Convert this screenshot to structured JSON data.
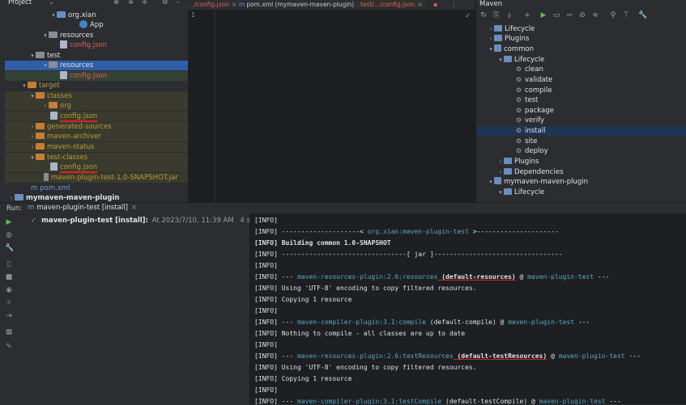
{
  "project": {
    "title": "Project",
    "items": [
      {
        "label": "org.xian"
      },
      {
        "label": "App"
      },
      {
        "label": "resources"
      },
      {
        "label": "config.json"
      },
      {
        "label": "test"
      },
      {
        "label": "resources"
      },
      {
        "label": "config.json"
      },
      {
        "label": "target"
      },
      {
        "label": "classes"
      },
      {
        "label": "org"
      },
      {
        "label": "config.json"
      },
      {
        "label": "generated-sources"
      },
      {
        "label": "maven-archiver"
      },
      {
        "label": "maven-status"
      },
      {
        "label": "test-classes"
      },
      {
        "label": "config.json"
      },
      {
        "label": "maven-plugin-test-1.0-SNAPSHOT.jar"
      },
      {
        "label": "pom.xml"
      },
      {
        "label": "mymaven-maven-plugin"
      }
    ]
  },
  "editor": {
    "tabs": [
      {
        "label": "../config.json"
      },
      {
        "label": "pom.xml (mymaven-maven-plugin)"
      },
      {
        "label": "test/.../config.json"
      }
    ],
    "line_number": "1",
    "check": "✓"
  },
  "maven": {
    "title": "Maven",
    "items": [
      {
        "label": "Lifecycle"
      },
      {
        "label": "Plugins"
      },
      {
        "label": "common"
      },
      {
        "label": "Lifecycle"
      },
      {
        "label": "clean"
      },
      {
        "label": "validate"
      },
      {
        "label": "compile"
      },
      {
        "label": "test"
      },
      {
        "label": "package"
      },
      {
        "label": "verify"
      },
      {
        "label": "install"
      },
      {
        "label": "site"
      },
      {
        "label": "deploy"
      },
      {
        "label": "Plugins"
      },
      {
        "label": "Dependencies"
      },
      {
        "label": "mymaven-maven-plugin"
      },
      {
        "label": "Lifecycle"
      }
    ]
  },
  "run": {
    "label": "Run:",
    "tab_label": "maven-plugin-test [install]",
    "task_label": "maven-plugin-test [install]:",
    "task_meta": "At 2023/7/10, 11:39 AM",
    "task_duration": "4 sec, 391 ms"
  },
  "console": {
    "lines": [
      {
        "prefix": "[INFO]",
        "text": ""
      },
      {
        "prefix": "[INFO]",
        "text": " --------------------< ",
        "plugin": "org.xian:maven-plugin-test",
        "rest": " >---------------------"
      },
      {
        "prefix": "[INFO]",
        "text": " Building common 1.0-SNAPSHOT"
      },
      {
        "prefix": "[INFO]",
        "text": " --------------------------------[ jar ]---------------------------------"
      },
      {
        "prefix": "[INFO]",
        "text": ""
      },
      {
        "prefix": "[INFO]",
        "text": " --- ",
        "plugin": "maven-resources-plugin:2.6:resources",
        "mid": " (default-resources)",
        "at": " @ ",
        "module": "maven-plugin-test",
        "rest": " ---"
      },
      {
        "prefix": "[INFO]",
        "text": " Using 'UTF-8' encoding to copy filtered resources."
      },
      {
        "prefix": "[INFO]",
        "text": " Copying 1 resource"
      },
      {
        "prefix": "[INFO]",
        "text": ""
      },
      {
        "prefix": "[INFO]",
        "text": " --- ",
        "plugin": "maven-compiler-plugin:3.1:compile",
        "mid": " (default-compile)",
        "at": " @ ",
        "module": "maven-plugin-test",
        "rest": " ---"
      },
      {
        "prefix": "[INFO]",
        "text": " Nothing to compile - all classes are up to date"
      },
      {
        "prefix": "[INFO]",
        "text": ""
      },
      {
        "prefix": "[INFO]",
        "text": " --- ",
        "plugin": "maven-resources-plugin:2.6:testResources",
        "mid": " (default-testResources)",
        "at": " @ ",
        "module": "maven-plugin-test",
        "rest": " ---"
      },
      {
        "prefix": "[INFO]",
        "text": " Using 'UTF-8' encoding to copy filtered resources."
      },
      {
        "prefix": "[INFO]",
        "text": " Copying 1 resource"
      },
      {
        "prefix": "[INFO]",
        "text": ""
      },
      {
        "prefix": "[INFO]",
        "text": " --- ",
        "plugin": "maven-compiler-plugin:3.1:testCompile",
        "mid": " (default-testCompile)",
        "at": " @ ",
        "module": "maven-plugin-test",
        "rest": " ---"
      }
    ]
  },
  "colors": {
    "accent": "#2e5fa8",
    "underline": "#e0201c",
    "plugin_text": "#56a8c5"
  }
}
